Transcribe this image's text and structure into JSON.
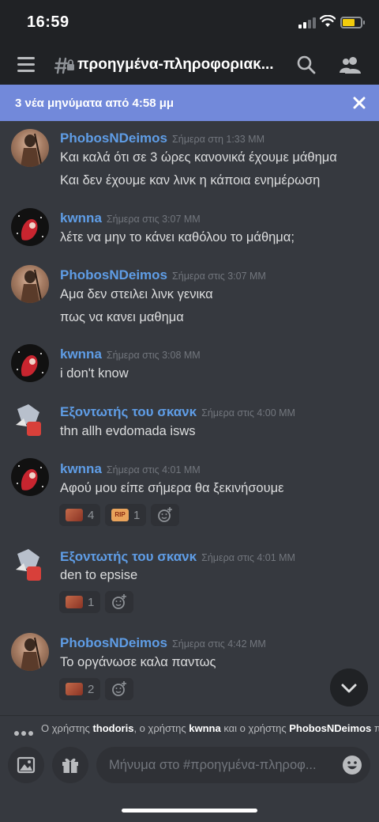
{
  "status": {
    "time": "16:59"
  },
  "header": {
    "channel_name": "προηγμένα-πληροφοριακ..."
  },
  "banner": {
    "text": "3 νέα μηνύματα από 4:58 μμ"
  },
  "messages": [
    {
      "author": "PhobosNDeimos",
      "timestamp": "Σήμερα στη 1:33 MM",
      "lines": [
        "Και καλά ότι σε 3 ώρες κανονικά έχουμε μάθημα",
        "Και δεν έχουμε καν λινκ η κάποια ενημέρωση"
      ]
    },
    {
      "author": "kwnna",
      "timestamp": "Σήμερα στις 3:07 MM",
      "lines": [
        "λέτε να μην το κάνει καθόλου το μάθημα;"
      ]
    },
    {
      "author": "PhobosNDeimos",
      "timestamp": "Σήμερα στις 3:07 MM",
      "lines": [
        "Αμα δεν στειλει λινκ γενικα",
        "πως να κανει μαθημα"
      ]
    },
    {
      "author": "kwnna",
      "timestamp": "Σήμερα στις 3:08 MM",
      "lines": [
        "i don't know"
      ]
    },
    {
      "author": "Εξοντωτής του σκανκ",
      "timestamp": "Σήμερα στις 4:00 MM",
      "lines": [
        "thn allh evdomada isws"
      ]
    },
    {
      "author": "kwnna",
      "timestamp": "Σήμερα στις 4:01 MM",
      "lines": [
        "Αφού μου είπε σήμερα θα ξεκινήσουμε"
      ],
      "reactions": [
        {
          "emoji": "face-emoji",
          "count": "4"
        },
        {
          "emoji": "rip-emoji",
          "count": "1"
        }
      ]
    },
    {
      "author": "Εξοντωτής του σκανκ",
      "timestamp": "Σήμερα στις 4:01 MM",
      "lines": [
        "den to epsise"
      ],
      "reactions": [
        {
          "emoji": "face-emoji",
          "count": "1"
        }
      ]
    },
    {
      "author": "PhobosNDeimos",
      "timestamp": "Σήμερα στις 4:42 MM",
      "lines": [
        "Το οργάνωσε καλα παντως"
      ],
      "reactions": [
        {
          "emoji": "face-emoji",
          "count": "2"
        }
      ]
    }
  ],
  "typing": {
    "prefix": "Ο χρήστης ",
    "user1": "thodoris",
    "sep1": ", ο χρήστης ",
    "user2": "kwnna",
    "sep2": " και ο χρήστης ",
    "user3": "PhobosNDeimos",
    "suffix": " πλ"
  },
  "composer": {
    "placeholder": "Μήνυμα στο #προηγμένα-πληροφ..."
  },
  "colors": {
    "background": "#36393f",
    "header": "#202225",
    "accent": "#7289da",
    "author": "#5f9de6"
  }
}
